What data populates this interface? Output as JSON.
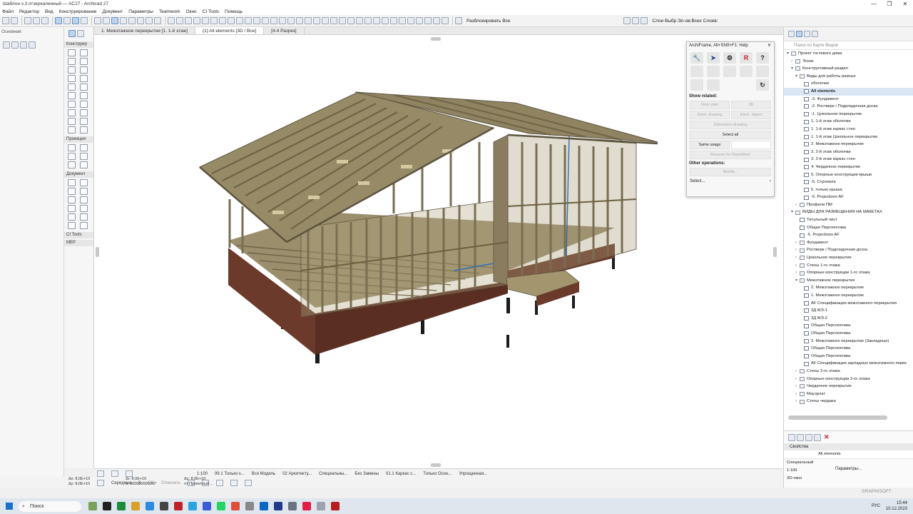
{
  "window": {
    "title": "Шаблон v.3 отзеркаленный — AC27 - Archicad 27",
    "controls": [
      "—",
      "❐",
      "✕"
    ]
  },
  "menu": [
    "Файл",
    "Редактор",
    "Вид",
    "Конструирование",
    "Документ",
    "Параметры",
    "Teamwork",
    "Окно",
    "CI Tools",
    "Помощь"
  ],
  "toolbar": {
    "unlock_all": "Разблокировать Все",
    "layers": "Слои Выбр.Эл-ов:Всех Слоев:"
  },
  "infobox": {
    "label": "Основная:"
  },
  "toolbox": {
    "sections": [
      "Конструир",
      "Проекция",
      "Документ",
      "CI Tools",
      "MEP"
    ]
  },
  "tabs": [
    {
      "label": "1. Межэтажное перекрытие [1. 1-й этаж]"
    },
    {
      "label": "{1} All elements [3D / Все]"
    },
    {
      "label": "[4-4 Разрез]"
    }
  ],
  "palette": {
    "title": "ArchiFrame, Alt+Shift+F1: Help",
    "show_related": "Show related:",
    "buttons": {
      "floor_plan": "Floor plan",
      "3d": "3D",
      "elem_drawing": "Elem. drawing",
      "elem_object": "Elem. object",
      "dimension_drawing": "Dimension drawing",
      "select_all": "Select all",
      "same_usage": "Same usage",
      "reserve": "Reserve for TeamWork"
    },
    "other_ops": "Other operations:",
    "modify": "Modify...",
    "select": "Select..."
  },
  "navigator": {
    "search_placeholder": "Поиск по Карте Видов",
    "tree": [
      {
        "label": "Проект гостевого дома",
        "level": 0,
        "exp": "▾",
        "type": "folder"
      },
      {
        "label": "Эскиз",
        "level": 1,
        "exp": "›",
        "type": "folder"
      },
      {
        "label": "Конструктивный раздел",
        "level": 1,
        "exp": "▾",
        "type": "folder"
      },
      {
        "label": "Виды для работы разные",
        "level": 2,
        "exp": "▾",
        "type": "folder"
      },
      {
        "label": "оболочки",
        "level": 3,
        "exp": "",
        "type": "view"
      },
      {
        "label": "All elements",
        "level": 3,
        "exp": "",
        "type": "view",
        "selected": true
      },
      {
        "label": "-3. Фундамент",
        "level": 3,
        "exp": "",
        "type": "view"
      },
      {
        "label": "-2. Ростверк / Подкладочная доска",
        "level": 3,
        "exp": "",
        "type": "view"
      },
      {
        "label": "-1. Цокольное перекрытие",
        "level": 3,
        "exp": "",
        "type": "view"
      },
      {
        "label": "1. 1-й этаж оболочки",
        "level": 3,
        "exp": "",
        "type": "view"
      },
      {
        "label": "1. 1-й этаж каркас стен",
        "level": 3,
        "exp": "",
        "type": "view"
      },
      {
        "label": "1. 1-й этаж Цокольное перекрытие",
        "level": 3,
        "exp": "",
        "type": "view"
      },
      {
        "label": "2. Межэтажное перекрытие",
        "level": 3,
        "exp": "",
        "type": "view"
      },
      {
        "label": "3. 2-й этаж оболочки",
        "level": 3,
        "exp": "",
        "type": "view"
      },
      {
        "label": "3. 2-й этаж каркас стен",
        "level": 3,
        "exp": "",
        "type": "view"
      },
      {
        "label": "4. Чердачное перекрытие",
        "level": 3,
        "exp": "",
        "type": "view"
      },
      {
        "label": "5. Опорные конструкции крыши",
        "level": 3,
        "exp": "",
        "type": "view"
      },
      {
        "label": "-5. Стропила",
        "level": 3,
        "exp": "",
        "type": "view"
      },
      {
        "label": "5. только крыша",
        "level": 3,
        "exp": "",
        "type": "view"
      },
      {
        "label": "-5. Projections AF",
        "level": 3,
        "exp": "",
        "type": "view"
      },
      {
        "label": "Профили ПМ",
        "level": 2,
        "exp": "›",
        "type": "folder"
      },
      {
        "label": "ВИДЫ ДЛЯ РАЗМЕЩЕНИЯ НА МАКЕТАХ",
        "level": 1,
        "exp": "▾",
        "type": "folder"
      },
      {
        "label": "Титульный лист",
        "level": 2,
        "exp": "",
        "type": "view"
      },
      {
        "label": "Общая Перспектива",
        "level": 2,
        "exp": "",
        "type": "view"
      },
      {
        "label": "-5. Projections AF",
        "level": 2,
        "exp": "",
        "type": "view"
      },
      {
        "label": "Фундамент",
        "level": 2,
        "exp": "›",
        "type": "folder"
      },
      {
        "label": "Ростверк / Подкладочная доска",
        "level": 2,
        "exp": "›",
        "type": "folder"
      },
      {
        "label": "Цокольное перекрытие",
        "level": 2,
        "exp": "›",
        "type": "folder"
      },
      {
        "label": "Стены 1-го этажа",
        "level": 2,
        "exp": "›",
        "type": "folder"
      },
      {
        "label": "Опорные конструкции 1-го этажа",
        "level": 2,
        "exp": "›",
        "type": "folder"
      },
      {
        "label": "Межэтажное перекрытие",
        "level": 2,
        "exp": "▾",
        "type": "folder"
      },
      {
        "label": "2. Межэтажное перекрытие",
        "level": 3,
        "exp": "",
        "type": "view"
      },
      {
        "label": "1. Межэтажное перекрытие",
        "level": 3,
        "exp": "",
        "type": "view"
      },
      {
        "label": "AF Спецификация межэтажного перекрытия",
        "level": 3,
        "exp": "",
        "type": "list"
      },
      {
        "label": "3Д МЭ-1",
        "level": 3,
        "exp": "",
        "type": "view"
      },
      {
        "label": "3Д МЭ-2",
        "level": 3,
        "exp": "",
        "type": "view"
      },
      {
        "label": "Общая Перспектива",
        "level": 3,
        "exp": "",
        "type": "view"
      },
      {
        "label": "Общая Перспектива",
        "level": 3,
        "exp": "",
        "type": "view"
      },
      {
        "label": "3. Межэтажное перекрытие (Закладные)",
        "level": 3,
        "exp": "",
        "type": "view"
      },
      {
        "label": "Общая Перспектива",
        "level": 3,
        "exp": "",
        "type": "view"
      },
      {
        "label": "Общая Перспектива",
        "level": 3,
        "exp": "",
        "type": "view"
      },
      {
        "label": "AF Спецификация закладных межэтажного перек",
        "level": 3,
        "exp": "",
        "type": "list"
      },
      {
        "label": "Стены 2-го этажа",
        "level": 2,
        "exp": "›",
        "type": "folder"
      },
      {
        "label": "Опорные конструкции 2-го этажа",
        "level": 2,
        "exp": "›",
        "type": "folder"
      },
      {
        "label": "Чердачное перекрытие",
        "level": 2,
        "exp": "›",
        "type": "folder"
      },
      {
        "label": "Мауэрлат",
        "level": 2,
        "exp": "›",
        "type": "folder"
      },
      {
        "label": "Стены чердака",
        "level": 2,
        "exp": "›",
        "type": "folder"
      }
    ]
  },
  "properties": {
    "header": "Свойства",
    "name": "All elements",
    "mode": "Специальный",
    "scale": "1:100",
    "view_type": "3D-окно",
    "params_button": "Параметры..."
  },
  "statusbar": {
    "scale": "1:100",
    "layer_combo": "99.1 Только к...",
    "model": "Вся Модель",
    "pen_set": "02 Архитекту...",
    "mvo": "Специальны...",
    "override": "Без Замены",
    "reno": "01.1 Каркас с...",
    "structure": "Только Осно...",
    "dims": "Упрощенная...",
    "ok": "OK",
    "cancel": "Отменить",
    "snap": "Середина",
    "snap_num": "2"
  },
  "coords": {
    "dx": "Δx: 8,0E+10",
    "dy": "Δy: 8,0E+10",
    "ang_r": "Δr: 8,0E+10",
    "ang": "α: 800000000,00°",
    "dz": "Δz: 8,0E+10",
    "ref": "от Проектный ..."
  },
  "brand": "GRAPHISOFT",
  "taskbar": {
    "search": "Поиск",
    "lang": "РУС",
    "time": "15:44",
    "date": "10.12.2023"
  },
  "colors": {
    "wood": "#8a7d5f",
    "wood_dark": "#5d5440",
    "base": "#6b3a2a",
    "accent": "#2f6fb6"
  }
}
